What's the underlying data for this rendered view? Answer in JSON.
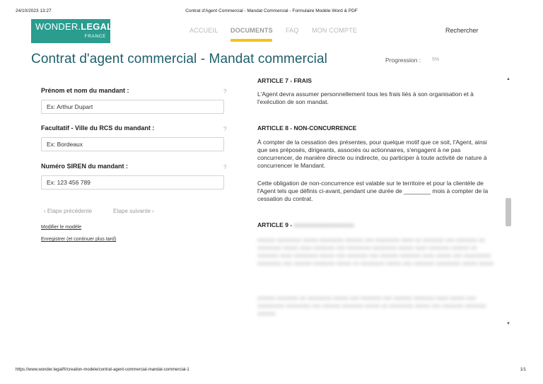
{
  "print": {
    "date": "24/10/2023 13:27",
    "title": "Contrat d'Agent Commercial - Mandat Commercial - Formulaire Modèle Word & PDF",
    "url": "https://www.wonder.legal/fr/creation-modele/contrat-agent-commercial-mandat-commercial-1",
    "page": "1/1"
  },
  "logo": {
    "prefix": "WONDER.",
    "bold": "LEGAL",
    "sub": "FRANCE"
  },
  "nav": {
    "items": [
      "ACCUEIL",
      "DOCUMENTS",
      "FAQ",
      "MON COMPTE"
    ],
    "active": "DOCUMENTS",
    "search": "Rechercher",
    "accent_color": "#f4c21b"
  },
  "page": {
    "title": "Contrat d'agent commercial - Mandat commercial",
    "progress_label": "Progression :",
    "progress_value": "5%"
  },
  "form": {
    "fields": [
      {
        "label": "Prénom et nom du mandant :",
        "value": "Ex: Arthur Dupart",
        "help": "?"
      },
      {
        "label": "Facultatif - Ville du RCS du mandant :",
        "value": "Ex: Bordeaux",
        "help": "?"
      },
      {
        "label": "Numéro SIREN du mandant :",
        "value": "Ex: 123 456 789",
        "help": "?"
      }
    ],
    "prev_step": "‹  Etape précédente",
    "next_step": "Etape suivante  ›",
    "modify_link": "Modifier le modèle",
    "save_link": "Enregistrer (et continuer plus tard)"
  },
  "document": {
    "art7_title": "ARTICLE 7 - FRAIS",
    "art7_p1": "L'Agent devra assumer personnellement tous les frais liés à son organisation et à l'exécution de son mandat.",
    "art8_title": "ARTICLE 8 - NON-CONCURRENCE",
    "art8_p1": "À compter de la cessation des présentes, pour quelque motif que ce soit, l'Agent, ainsi que ses préposés, dirigeants, associés ou actionnaires, s'engagent à ne pas concurrencer, de manière directe ou indirecte, ou participer à toute activité de nature à concurrencer le Mandant.",
    "art8_p2": "Cette obligation de non-concurrence est valable sur le territoire et pour la clientèle de l'Agent tels que définis ci-avant, pendant une durée de ________ mois à compter de la cessation du contrat.",
    "art9_title": "ARTICLE 9 -"
  },
  "colors": {
    "brand": "#2a9d8f",
    "title": "#1d5f6a"
  }
}
